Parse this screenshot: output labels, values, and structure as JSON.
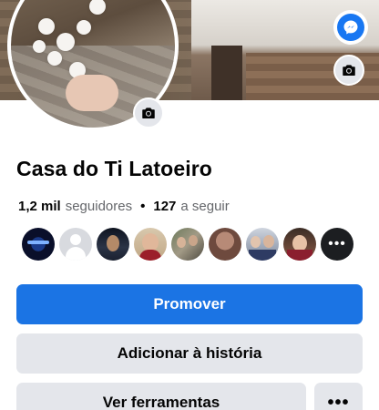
{
  "page": {
    "name": "Casa do Ti Latoeiro",
    "followers_count": "1,2 mil",
    "followers_label": "seguidores",
    "separator": "•",
    "following_count": "127",
    "following_label": "a seguir"
  },
  "cover": {
    "camera_icon": "camera-icon"
  },
  "profile_picture": {
    "camera_icon": "camera-icon"
  },
  "messenger": {
    "icon": "messenger-icon",
    "color": "#1877f2"
  },
  "follower_avatars": {
    "more_icon": "more-dots-icon",
    "items": [
      "avatar-1",
      "avatar-2",
      "avatar-3",
      "avatar-4",
      "avatar-5",
      "avatar-6",
      "avatar-7",
      "avatar-8"
    ]
  },
  "actions": {
    "promote_label": "Promover",
    "add_story_label": "Adicionar à história",
    "tools_label": "Ver ferramentas",
    "more_label": "•••"
  },
  "colors": {
    "primary": "#1b74e4",
    "secondary_button": "#e4e6eb",
    "text_secondary": "#65676b"
  }
}
